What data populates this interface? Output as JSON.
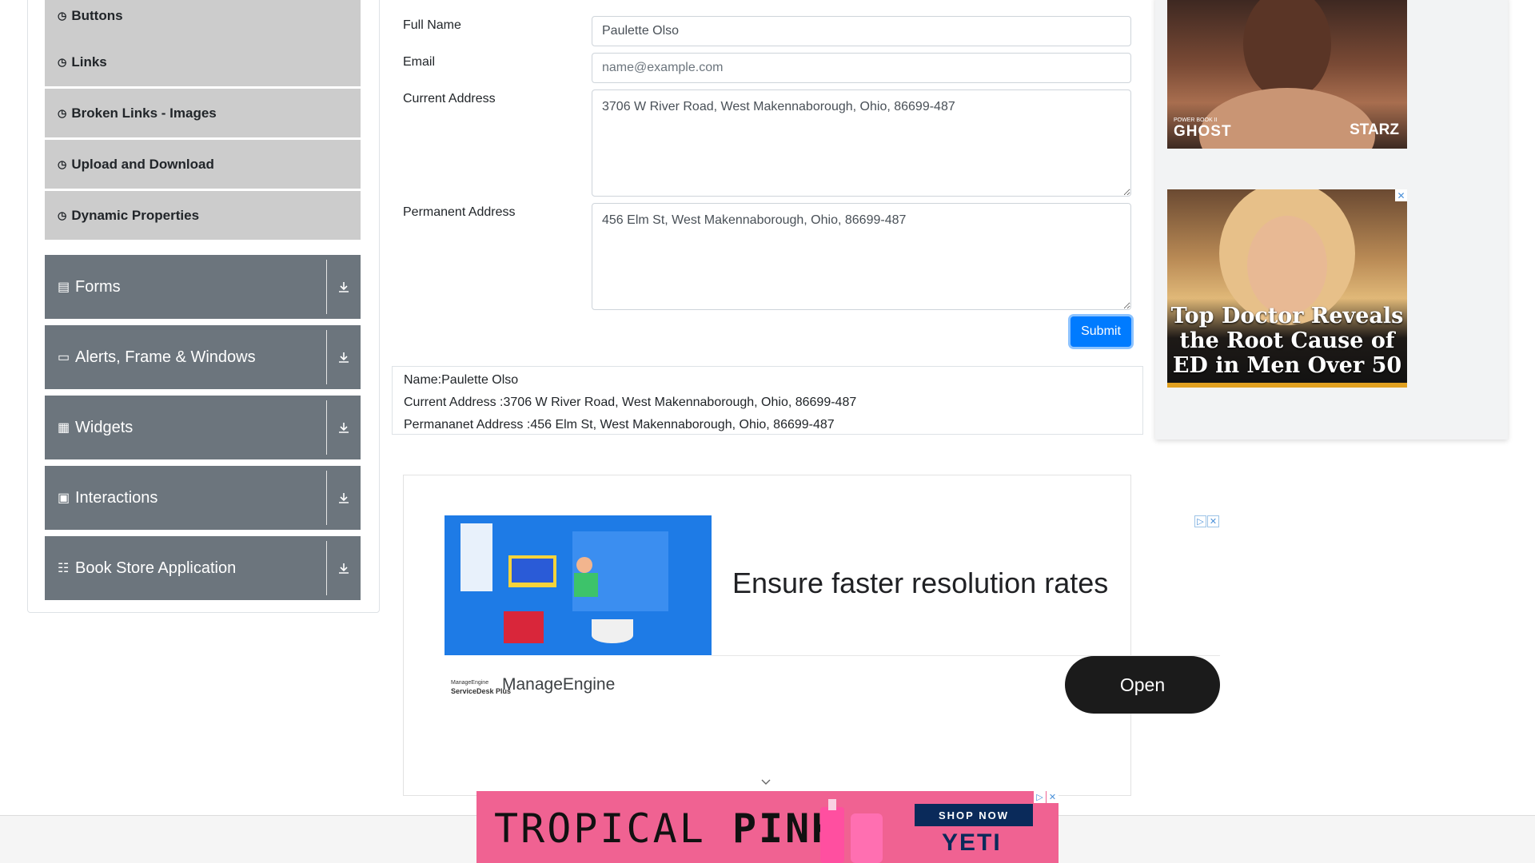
{
  "sidebar": {
    "elements_items": [
      {
        "label": "Buttons",
        "icon": "element-icon"
      },
      {
        "label": "Links",
        "icon": "element-icon"
      },
      {
        "label": "Broken Links - Images",
        "icon": "element-icon"
      },
      {
        "label": "Upload and Download",
        "icon": "element-icon"
      },
      {
        "label": "Dynamic Properties",
        "icon": "element-icon"
      }
    ],
    "groups": [
      {
        "label": "Forms",
        "icon": "forms-icon"
      },
      {
        "label": "Alerts, Frame & Windows",
        "icon": "window-icon"
      },
      {
        "label": "Widgets",
        "icon": "widgets-icon"
      },
      {
        "label": "Interactions",
        "icon": "interactions-icon"
      },
      {
        "label": "Book Store Application",
        "icon": "books-icon"
      }
    ]
  },
  "form": {
    "full_name_label": "Full Name",
    "full_name_value": "Paulette Olso",
    "email_label": "Email",
    "email_placeholder": "name@example.com",
    "current_address_label": "Current Address",
    "current_address_value": "3706 W River Road, West Makennaborough, Ohio, 86699-487",
    "permanent_address_label": "Permanent Address",
    "permanent_address_value": "456 Elm St, West Makennaborough, Ohio, 86699-487",
    "submit_label": "Submit"
  },
  "output": {
    "name": "Name:Paulette Olso",
    "current_address": "Current Address :3706 W River Road, West Makennaborough, Ohio, 86699-487",
    "permanent_address": "Permananet Address :456 Elm St, West Makennaborough, Ohio, 86699-487"
  },
  "ads": {
    "manageengine": {
      "headline": "Ensure faster resolution rates",
      "brand": "ManageEngine",
      "logo_text_1": "ManageEngine",
      "logo_text_2": "ServiceDesk Plus",
      "cta": "Open"
    },
    "ghost": {
      "logo_small": "POWER BOOK II",
      "logo_left": "GHOST",
      "logo_right": "STARZ"
    },
    "doctor": {
      "headline": "Top Doctor Reveals the Root Cause of ED in Men Over 50"
    },
    "yeti": {
      "tropical": "TROPICAL",
      "pink": "PINK",
      "shop": "SHOP NOW",
      "brand": "YETI"
    },
    "adchoice_icon": "adchoices-icon",
    "close_icon": "close-icon"
  },
  "colors": {
    "primary": "#007bff",
    "sidebar_group": "#6c757d",
    "sidebar_item": "#cccccc",
    "yeti_pink": "#f06292"
  }
}
